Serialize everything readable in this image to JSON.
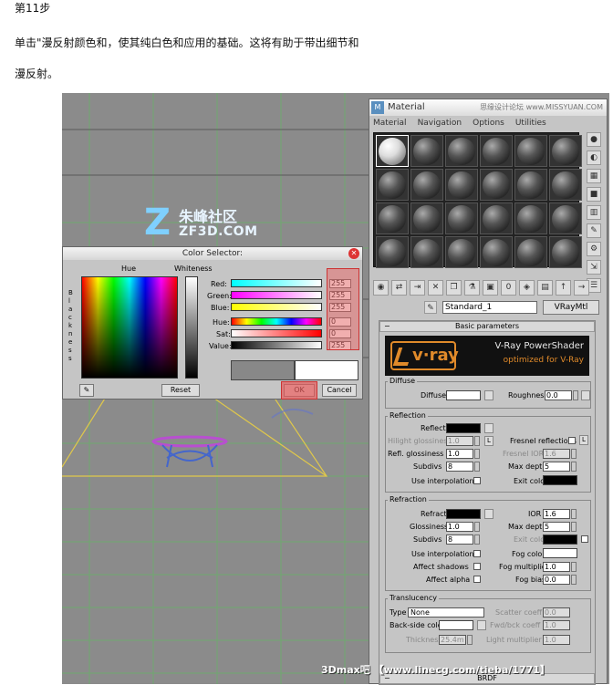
{
  "doc": {
    "step": "第11步",
    "para1": "单击\"漫反射颜色和，使其纯白色和应用的基础。这将有助于带出细节和",
    "para2": "漫反射。"
  },
  "logo": {
    "cn": "朱峰社区",
    "en": "ZF3D.COM"
  },
  "material_editor": {
    "title": "Material",
    "title_watermark": "思缘设计论坛 www.MISSYUAN.COM",
    "menu": [
      "Material",
      "Navigation",
      "Options",
      "Utilities"
    ],
    "material_name": "Standard_1",
    "material_type": "VRayMtl",
    "rollout_title": "Basic parameters",
    "banner_line1": "V-Ray PowerShader",
    "banner_line2": "optimized for V-Ray",
    "vray_logo": "v·ray",
    "diffuse": {
      "title": "Diffuse",
      "label": "Diffuse",
      "roughness_label": "Roughness",
      "roughness": "0.0"
    },
    "reflection": {
      "title": "Reflection",
      "reflect": "Reflect",
      "hilight_glossiness": "Hilight glossiness",
      "hilight_value": "1.0",
      "l": "L",
      "refl_glossiness": "Refl. glossiness",
      "refl_value": "1.0",
      "subdivs": "Subdivs",
      "subdivs_value": "8",
      "use_interpolation": "Use interpolation",
      "fresnel_reflections": "Fresnel reflections",
      "fresnel_ior": "Fresnel IOR",
      "fresnel_ior_value": "1.6",
      "max_depth": "Max depth",
      "max_depth_value": "5",
      "exit_color": "Exit color"
    },
    "refraction": {
      "title": "Refraction",
      "refract": "Refract",
      "glossiness": "Glossiness",
      "glossiness_value": "1.0",
      "subdivs": "Subdivs",
      "subdivs_value": "8",
      "use_interpolation": "Use interpolation",
      "affect_shadows": "Affect shadows",
      "affect_alpha": "Affect alpha",
      "ior": "IOR",
      "ior_value": "1.6",
      "max_depth": "Max depth",
      "max_depth_value": "5",
      "exit_color": "Exit color",
      "fog_color": "Fog color",
      "fog_multiplier": "Fog multiplier",
      "fog_multiplier_value": "1.0",
      "fog_bias": "Fog bias",
      "fog_bias_value": "0.0"
    },
    "translucency": {
      "title": "Translucency",
      "type_label": "Type",
      "type_value": "None",
      "back_side_color": "Back-side color",
      "thickness": "Thickness",
      "thickness_value": "25.4m",
      "scatter_coeff": "Scatter coeff",
      "scatter_value": "0.0",
      "fwd_bck_coeff": "Fwd/bck coeff",
      "fwd_value": "1.0",
      "light_multiplier": "Light multiplier",
      "light_value": "1.0"
    },
    "brdf": "BRDF"
  },
  "color_selector": {
    "title": "Color Selector:",
    "hue_label": "Hue",
    "whiteness_label": "Whiteness",
    "blackness_letters": "B l a c k n e s s",
    "channels": [
      {
        "label": "Red:",
        "value": "255"
      },
      {
        "label": "Green:",
        "value": "255"
      },
      {
        "label": "Blue:",
        "value": "255"
      },
      {
        "label": "Hue:",
        "value": "0"
      },
      {
        "label": "Sat:",
        "value": "0"
      },
      {
        "label": "Value:",
        "value": "255"
      }
    ],
    "reset": "Reset",
    "ok": "OK",
    "cancel": "Cancel"
  },
  "footer_watermark": "3Dmax吧 【www.linecg.com/tieba/1771】"
}
